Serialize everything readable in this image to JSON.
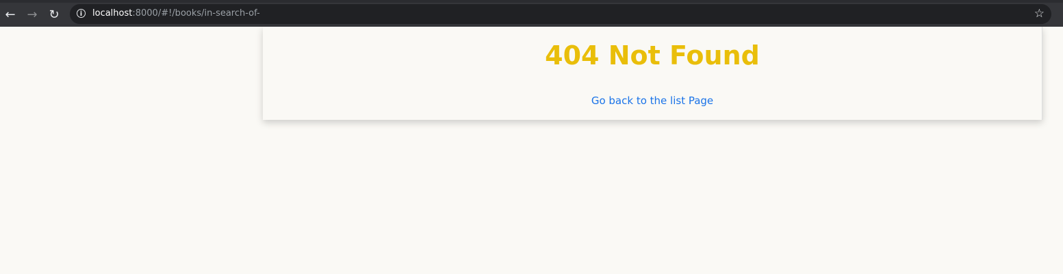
{
  "browser": {
    "url_host": "localhost",
    "url_rest": ":8000/#!/books/in-search-of-"
  },
  "page": {
    "title": "404 Not Found",
    "back_link": "Go back to the list Page"
  },
  "colors": {
    "title": "#e9be0a",
    "link": "#1a73e8"
  }
}
